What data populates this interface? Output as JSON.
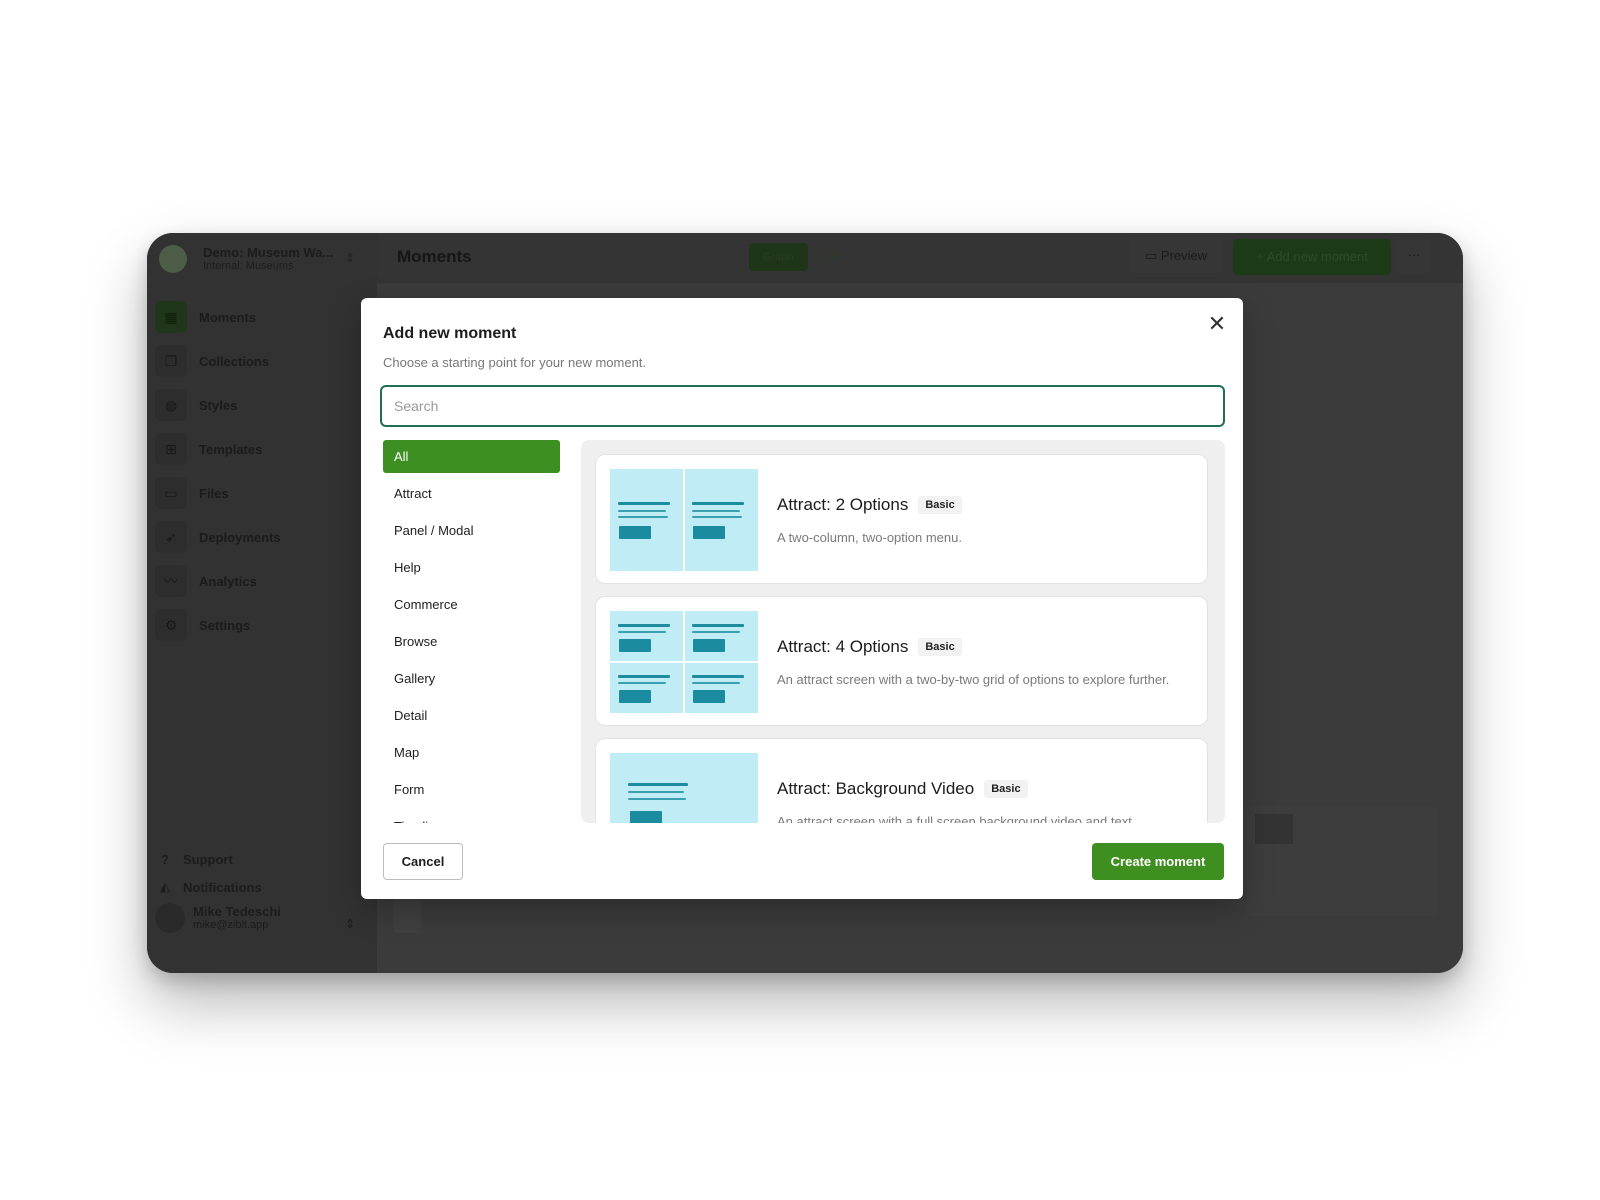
{
  "app": {
    "org_name": "Demo: Museum Wa...",
    "org_sub": "Internal: Museums",
    "page_title": "Moments",
    "view_tabs": [
      "Graph",
      "List"
    ],
    "preview_label": "Preview",
    "add_moment_label": "Add new moment",
    "more_label": "···"
  },
  "sidebar": {
    "items": [
      {
        "label": "Moments",
        "icon": "moments-icon",
        "active": true
      },
      {
        "label": "Collections",
        "icon": "collections-icon"
      },
      {
        "label": "Styles",
        "icon": "palette-icon"
      },
      {
        "label": "Templates",
        "icon": "templates-icon"
      },
      {
        "label": "Files",
        "icon": "folder-icon"
      },
      {
        "label": "Deployments",
        "icon": "rocket-icon"
      },
      {
        "label": "Analytics",
        "icon": "analytics-icon"
      },
      {
        "label": "Settings",
        "icon": "gear-icon"
      }
    ],
    "support_label": "Support",
    "notifications_label": "Notifications",
    "user_name": "Mike Tedeschi",
    "user_email": "mike@zibit.app"
  },
  "modal": {
    "title": "Add new moment",
    "subtitle": "Choose a starting point for your new moment.",
    "search_placeholder": "Search",
    "categories": [
      "All",
      "Attract",
      "Panel / Modal",
      "Help",
      "Commerce",
      "Browse",
      "Gallery",
      "Detail",
      "Map",
      "Form",
      "Timeline"
    ],
    "active_category": "All",
    "templates": [
      {
        "title": "Attract: 2 Options",
        "badge": "Basic",
        "description": "A two-column, two-option menu."
      },
      {
        "title": "Attract: 4 Options",
        "badge": "Basic",
        "description": "An attract screen with a two-by-two grid of options to explore further."
      },
      {
        "title": "Attract: Background Video",
        "badge": "Basic",
        "description": "An attract screen with a full screen background video and text"
      }
    ],
    "cancel_label": "Cancel",
    "create_label": "Create moment"
  },
  "colors": {
    "accent": "#3e8e20",
    "focus": "#1f6e55",
    "thumb": "#c0edf5",
    "thumb_ink": "#1b8ba0"
  }
}
